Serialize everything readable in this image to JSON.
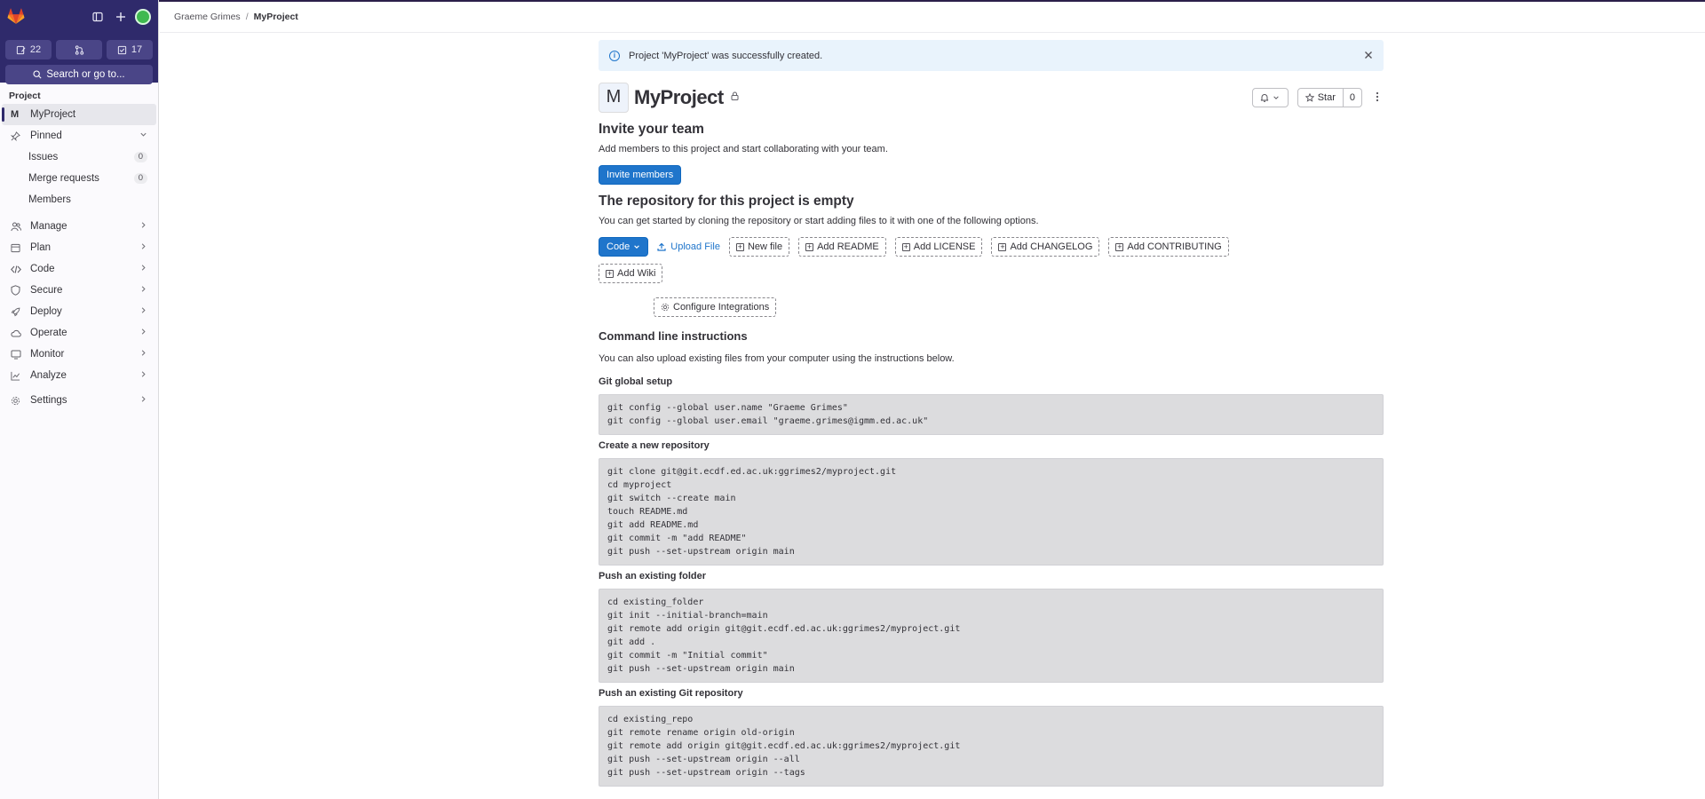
{
  "sidebar": {
    "counters": [
      {
        "icon": "issues-icon",
        "count": "22"
      },
      {
        "icon": "merge-request-icon",
        "count": ""
      },
      {
        "icon": "todo-icon",
        "count": "17"
      }
    ],
    "search_label": "Search or go to...",
    "section_label": "Project",
    "project_item": {
      "letter": "M",
      "label": "MyProject"
    },
    "pinned_label": "Pinned",
    "pinned_items": [
      {
        "label": "Issues",
        "count": "0"
      },
      {
        "label": "Merge requests",
        "count": "0"
      },
      {
        "label": "Members",
        "count": ""
      }
    ],
    "nav_items": [
      {
        "label": "Manage",
        "icon": "users-icon"
      },
      {
        "label": "Plan",
        "icon": "plan-icon"
      },
      {
        "label": "Code",
        "icon": "code-icon"
      },
      {
        "label": "Secure",
        "icon": "shield-icon"
      },
      {
        "label": "Deploy",
        "icon": "rocket-icon"
      },
      {
        "label": "Operate",
        "icon": "cloud-icon"
      },
      {
        "label": "Monitor",
        "icon": "monitor-icon"
      },
      {
        "label": "Analyze",
        "icon": "chart-icon"
      }
    ],
    "settings_label": "Settings"
  },
  "breadcrumb": {
    "parent": "Graeme Grimes",
    "separator": "/",
    "current": "MyProject"
  },
  "alert": {
    "message": "Project 'MyProject' was successfully created."
  },
  "project": {
    "avatar_letter": "M",
    "title": "MyProject",
    "star_label": "Star",
    "star_count": "0"
  },
  "invite": {
    "title": "Invite your team",
    "description": "Add members to this project and start collaborating with your team.",
    "button": "Invite members"
  },
  "empty_repo": {
    "title": "The repository for this project is empty",
    "description": "You can get started by cloning the repository or start adding files to it with one of the following options.",
    "code_button": "Code",
    "upload_label": "Upload File",
    "buttons": [
      "New file",
      "Add README",
      "Add LICENSE",
      "Add CHANGELOG",
      "Add CONTRIBUTING",
      "Add Wiki"
    ],
    "integrations_label": "Configure Integrations"
  },
  "cli": {
    "title": "Command line instructions",
    "description": "You can also upload existing files from your computer using the instructions below.",
    "sections": [
      {
        "title": "Git global setup",
        "code": "git config --global user.name \"Graeme Grimes\"\ngit config --global user.email \"graeme.grimes@igmm.ed.ac.uk\""
      },
      {
        "title": "Create a new repository",
        "code": "git clone git@git.ecdf.ed.ac.uk:ggrimes2/myproject.git\ncd myproject\ngit switch --create main\ntouch README.md\ngit add README.md\ngit commit -m \"add README\"\ngit push --set-upstream origin main"
      },
      {
        "title": "Push an existing folder",
        "code": "cd existing_folder\ngit init --initial-branch=main\ngit remote add origin git@git.ecdf.ed.ac.uk:ggrimes2/myproject.git\ngit add .\ngit commit -m \"Initial commit\"\ngit push --set-upstream origin main"
      },
      {
        "title": "Push an existing Git repository",
        "code": "cd existing_repo\ngit remote rename origin old-origin\ngit remote add origin git@git.ecdf.ed.ac.uk:ggrimes2/myproject.git\ngit push --set-upstream origin --all\ngit push --set-upstream origin --tags"
      }
    ]
  }
}
